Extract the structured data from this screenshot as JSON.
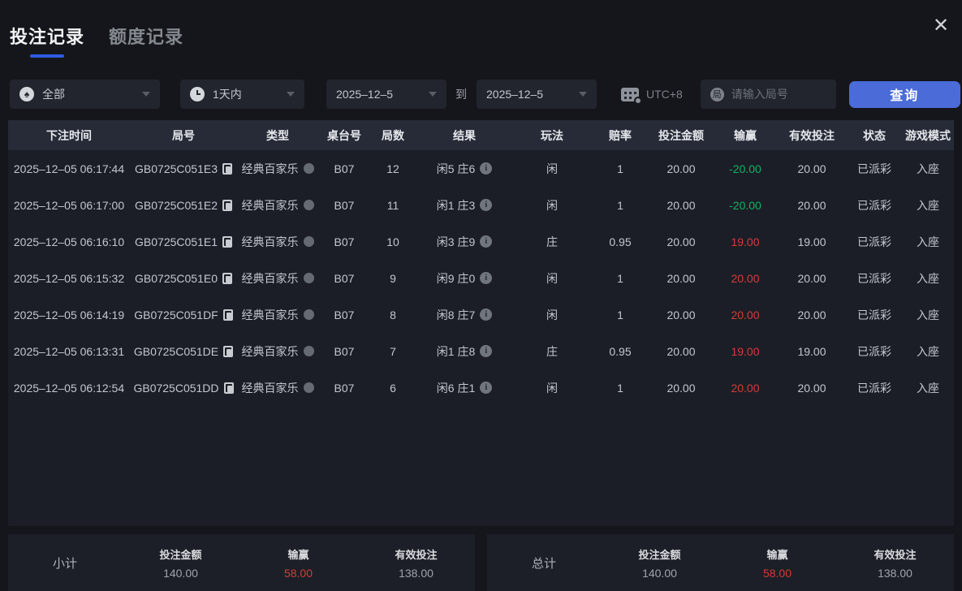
{
  "tabs": [
    {
      "label": "投注记录",
      "active": true
    },
    {
      "label": "额度记录",
      "active": false
    }
  ],
  "icons": {
    "close": "✕",
    "spade": "♠",
    "round_badge": "局",
    "info": "i"
  },
  "filters": {
    "game_type_value": "全部",
    "time_range_value": "1天内",
    "date_from": "2025–12–5",
    "to_label": "到",
    "date_to": "2025–12–5",
    "timezone": "UTC+8",
    "round_placeholder": "请输入局号",
    "query_label": "查询"
  },
  "table": {
    "headers": [
      "下注时间",
      "局号",
      "类型",
      "桌台号",
      "局数",
      "结果",
      "玩法",
      "赔率",
      "投注金额",
      "输赢",
      "有效投注",
      "状态",
      "游戏模式"
    ],
    "rows": [
      {
        "time": "2025–12–05 06:17:44",
        "round_id": "GB0725C051E3",
        "type": "经典百家乐",
        "table_no": "B07",
        "round_no": "12",
        "result": "闲5 庄6",
        "play": "闲",
        "odds": "1",
        "bet": "20.00",
        "win": "-20.00",
        "win_color": "green",
        "valid": "20.00",
        "status": "已派彩",
        "mode": "入座"
      },
      {
        "time": "2025–12–05 06:17:00",
        "round_id": "GB0725C051E2",
        "type": "经典百家乐",
        "table_no": "B07",
        "round_no": "11",
        "result": "闲1 庄3",
        "play": "闲",
        "odds": "1",
        "bet": "20.00",
        "win": "-20.00",
        "win_color": "green",
        "valid": "20.00",
        "status": "已派彩",
        "mode": "入座"
      },
      {
        "time": "2025–12–05 06:16:10",
        "round_id": "GB0725C051E1",
        "type": "经典百家乐",
        "table_no": "B07",
        "round_no": "10",
        "result": "闲3 庄9",
        "play": "庄",
        "odds": "0.95",
        "bet": "20.00",
        "win": "19.00",
        "win_color": "red",
        "valid": "19.00",
        "status": "已派彩",
        "mode": "入座"
      },
      {
        "time": "2025–12–05 06:15:32",
        "round_id": "GB0725C051E0",
        "type": "经典百家乐",
        "table_no": "B07",
        "round_no": "9",
        "result": "闲9 庄0",
        "play": "闲",
        "odds": "1",
        "bet": "20.00",
        "win": "20.00",
        "win_color": "red",
        "valid": "20.00",
        "status": "已派彩",
        "mode": "入座"
      },
      {
        "time": "2025–12–05 06:14:19",
        "round_id": "GB0725C051DF",
        "type": "经典百家乐",
        "table_no": "B07",
        "round_no": "8",
        "result": "闲8 庄7",
        "play": "闲",
        "odds": "1",
        "bet": "20.00",
        "win": "20.00",
        "win_color": "red",
        "valid": "20.00",
        "status": "已派彩",
        "mode": "入座"
      },
      {
        "time": "2025–12–05 06:13:31",
        "round_id": "GB0725C051DE",
        "type": "经典百家乐",
        "table_no": "B07",
        "round_no": "7",
        "result": "闲1 庄8",
        "play": "庄",
        "odds": "0.95",
        "bet": "20.00",
        "win": "19.00",
        "win_color": "red",
        "valid": "19.00",
        "status": "已派彩",
        "mode": "入座"
      },
      {
        "time": "2025–12–05 06:12:54",
        "round_id": "GB0725C051DD",
        "type": "经典百家乐",
        "table_no": "B07",
        "round_no": "6",
        "result": "闲6 庄1",
        "play": "闲",
        "odds": "1",
        "bet": "20.00",
        "win": "20.00",
        "win_color": "red",
        "valid": "20.00",
        "status": "已派彩",
        "mode": "入座"
      }
    ]
  },
  "summary": {
    "subtotal": {
      "title": "小计",
      "bet_label": "投注金额",
      "bet": "140.00",
      "win_label": "输赢",
      "win": "58.00",
      "valid_label": "有效投注",
      "valid": "138.00"
    },
    "total": {
      "title": "总计",
      "bet_label": "投注金额",
      "bet": "140.00",
      "win_label": "输赢",
      "win": "58.00",
      "valid_label": "有效投注",
      "valid": "138.00"
    }
  },
  "colors": {
    "accent": "#4a6bd8",
    "tab_underline": "#2e5ce2",
    "win_positive": "#d63b3b",
    "win_negative": "#0db564"
  }
}
